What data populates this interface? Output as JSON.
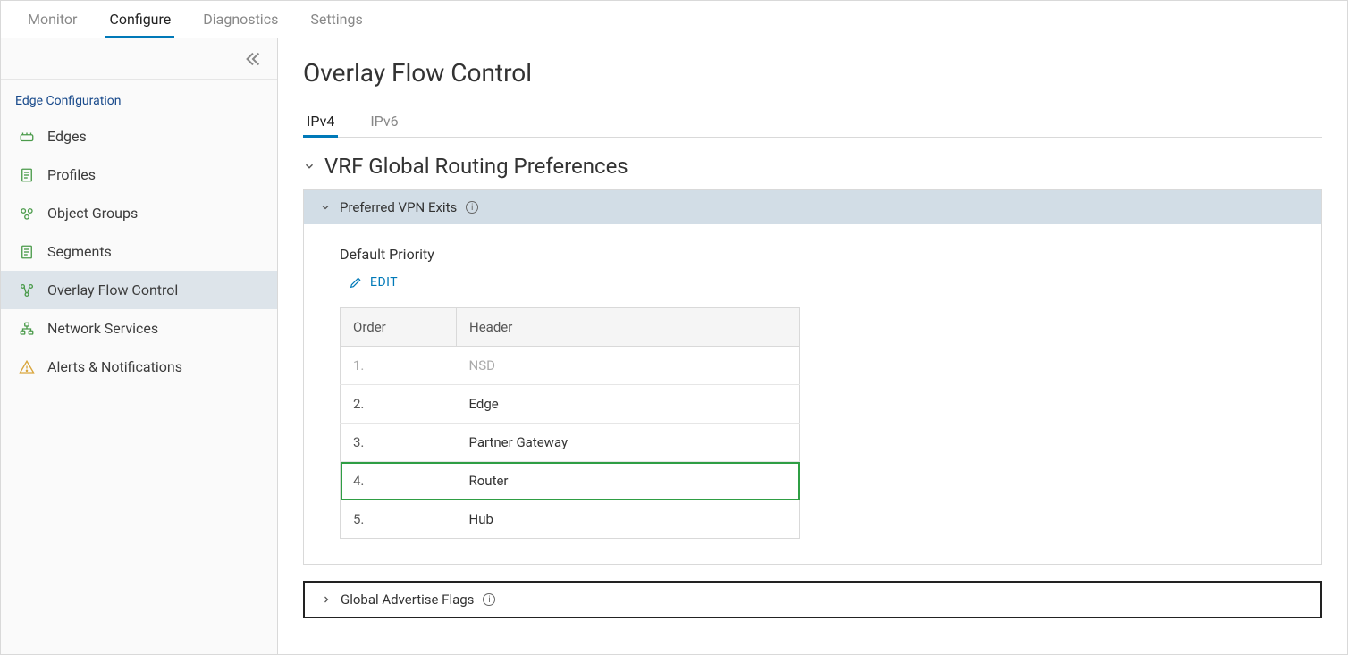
{
  "topTabs": {
    "monitor": "Monitor",
    "configure": "Configure",
    "diagnostics": "Diagnostics",
    "settings": "Settings"
  },
  "sidebar": {
    "sectionTitle": "Edge Configuration",
    "items": {
      "edges": "Edges",
      "profiles": "Profiles",
      "objectGroups": "Object Groups",
      "segments": "Segments",
      "overlayFlowControl": "Overlay Flow Control",
      "networkServices": "Network Services",
      "alertsNotifications": "Alerts & Notifications"
    }
  },
  "page": {
    "title": "Overlay Flow Control",
    "subTabs": {
      "ipv4": "IPv4",
      "ipv6": "IPv6"
    },
    "sectionTitle": "VRF Global Routing Preferences",
    "vpnExits": {
      "header": "Preferred VPN Exits",
      "subsectionTitle": "Default Priority",
      "editLabel": "EDIT",
      "columns": {
        "order": "Order",
        "header": "Header"
      },
      "rows": [
        {
          "order": "1.",
          "header": "NSD",
          "dim": true,
          "highlight": false
        },
        {
          "order": "2.",
          "header": "Edge",
          "dim": false,
          "highlight": false
        },
        {
          "order": "3.",
          "header": "Partner Gateway",
          "dim": false,
          "highlight": false
        },
        {
          "order": "4.",
          "header": "Router",
          "dim": false,
          "highlight": true
        },
        {
          "order": "5.",
          "header": "Hub",
          "dim": false,
          "highlight": false
        }
      ]
    },
    "advertiseFlags": {
      "header": "Global Advertise Flags"
    }
  }
}
